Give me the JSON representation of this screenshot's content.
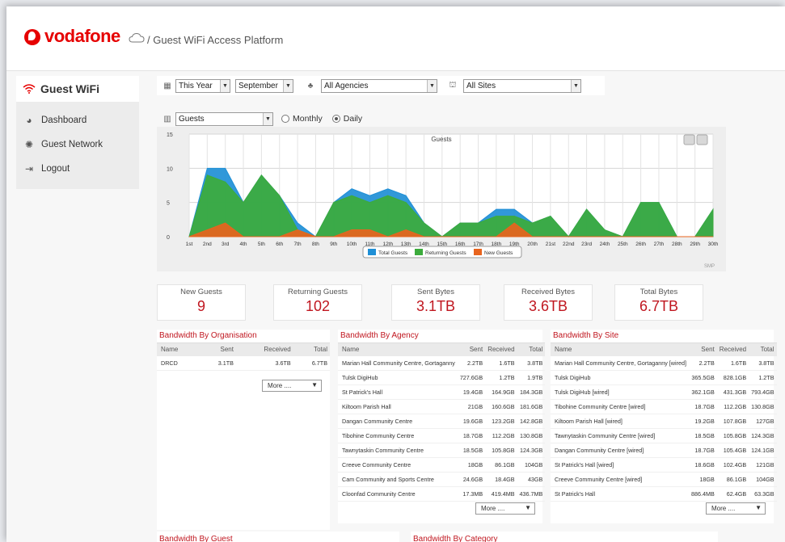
{
  "header": {
    "brand": "vodafone",
    "breadcrumb": "/ Guest WiFi Access Platform"
  },
  "sidebar": {
    "title": "Guest WiFi",
    "items": [
      {
        "label": "Dashboard",
        "icon": "dashboard-icon"
      },
      {
        "label": "Guest Network",
        "icon": "network-icon"
      },
      {
        "label": "Logout",
        "icon": "logout-icon"
      }
    ]
  },
  "filters": {
    "period": "This Year",
    "month": "September",
    "agency": "All Agencies",
    "site": "All Sites",
    "metric": "Guests",
    "granularity_monthly": "Monthly",
    "granularity_daily": "Daily",
    "granularity_selected": "Daily"
  },
  "chart_data": {
    "type": "area",
    "title": "Guests",
    "credit": "SMP",
    "categories": [
      "1st",
      "2nd",
      "3rd",
      "4th",
      "5th",
      "6th",
      "7th",
      "8th",
      "9th",
      "10th",
      "11th",
      "12th",
      "13th",
      "14th",
      "15th",
      "16th",
      "17th",
      "18th",
      "19th",
      "20th",
      "21st",
      "22nd",
      "23rd",
      "24th",
      "25th",
      "26th",
      "27th",
      "28th",
      "29th",
      "30th"
    ],
    "ylim": [
      0,
      15
    ],
    "yticks": [
      0,
      5,
      10,
      15
    ],
    "legend_position": "bottom",
    "series": [
      {
        "name": "Total Guests",
        "color": "#1f8fd6",
        "values": [
          0,
          10,
          10,
          5,
          9,
          6,
          2,
          0,
          5,
          7,
          6,
          7,
          6,
          2,
          0,
          2,
          2,
          4,
          4,
          2,
          3,
          0,
          4,
          1,
          0,
          5,
          5,
          0,
          0,
          4
        ]
      },
      {
        "name": "Returning Guests",
        "color": "#3cab3c",
        "values": [
          0,
          9,
          8,
          5,
          9,
          6,
          1,
          0,
          5,
          6,
          5,
          6,
          5,
          2,
          0,
          2,
          2,
          3,
          3,
          2,
          3,
          0,
          4,
          1,
          0,
          5,
          5,
          0,
          0,
          4
        ]
      },
      {
        "name": "New Guests",
        "color": "#e8641e",
        "values": [
          0,
          1,
          2,
          0,
          0,
          0,
          1,
          0,
          0,
          1,
          1,
          0,
          1,
          0,
          0,
          0,
          0,
          0,
          2,
          0,
          0,
          0,
          0,
          0,
          0,
          0,
          0,
          0,
          0,
          0
        ]
      }
    ]
  },
  "kpis": [
    {
      "label": "New Guests",
      "value": "9"
    },
    {
      "label": "Returning Guests",
      "value": "102"
    },
    {
      "label": "Sent Bytes",
      "value": "3.1TB"
    },
    {
      "label": "Received Bytes",
      "value": "3.6TB"
    },
    {
      "label": "Total Bytes",
      "value": "6.7TB"
    }
  ],
  "org_panel": {
    "title": "Bandwidth By Organisation",
    "headers": [
      "Name",
      "Sent",
      "Received",
      "Total"
    ],
    "rows": [
      [
        "DRCD",
        "3.1TB",
        "3.6TB",
        "6.7TB"
      ]
    ],
    "more": "More ...."
  },
  "agency_panel": {
    "title": "Bandwidth By Agency",
    "headers": [
      "Name",
      "Sent",
      "Received",
      "Total"
    ],
    "rows": [
      [
        "Marian Hall Community Centre, Gortaganny",
        "2.2TB",
        "1.6TB",
        "3.8TB"
      ],
      [
        "Tulsk DigiHub",
        "727.6GB",
        "1.2TB",
        "1.9TB"
      ],
      [
        "St Patrick's Hall",
        "19.4GB",
        "164.9GB",
        "184.3GB"
      ],
      [
        "Kiltoom Parish Hall",
        "21GB",
        "160.6GB",
        "181.6GB"
      ],
      [
        "Dangan Community Centre",
        "19.6GB",
        "123.2GB",
        "142.8GB"
      ],
      [
        "Tibohine Community Centre",
        "18.7GB",
        "112.2GB",
        "130.8GB"
      ],
      [
        "Tawnytaskin Community Centre",
        "18.5GB",
        "105.8GB",
        "124.3GB"
      ],
      [
        "Creeve Community Centre",
        "18GB",
        "86.1GB",
        "104GB"
      ],
      [
        "Cam Community and Sports Centre",
        "24.6GB",
        "18.4GB",
        "43GB"
      ],
      [
        "Cloonfad Community Centre",
        "17.3MB",
        "419.4MB",
        "436.7MB"
      ]
    ],
    "more": "More ...."
  },
  "site_panel": {
    "title": "Bandwidth By Site",
    "headers": [
      "Name",
      "Sent",
      "Received",
      "Total"
    ],
    "rows": [
      [
        "Marian Hall Community Centre, Gortaganny [wired]",
        "2.2TB",
        "1.6TB",
        "3.8TB"
      ],
      [
        "Tulsk DigiHub",
        "365.5GB",
        "828.1GB",
        "1.2TB"
      ],
      [
        "Tulsk DigiHub [wired]",
        "362.1GB",
        "431.3GB",
        "793.4GB"
      ],
      [
        "Tibohine Community Centre [wired]",
        "18.7GB",
        "112.2GB",
        "130.8GB"
      ],
      [
        "Kiltoom Parish Hall [wired]",
        "19.2GB",
        "107.8GB",
        "127GB"
      ],
      [
        "Tawnytaskin Community Centre [wired]",
        "18.5GB",
        "105.8GB",
        "124.3GB"
      ],
      [
        "Dangan Community Centre [wired]",
        "18.7GB",
        "105.4GB",
        "124.1GB"
      ],
      [
        "St Patrick's Hall [wired]",
        "18.6GB",
        "102.4GB",
        "121GB"
      ],
      [
        "Creeve Community Centre [wired]",
        "18GB",
        "86.1GB",
        "104GB"
      ],
      [
        "St Patrick's Hall",
        "886.4MB",
        "62.4GB",
        "63.3GB"
      ]
    ],
    "more": "More ...."
  },
  "bottom": {
    "guest_title": "Bandwidth By Guest",
    "category_title": "Bandwidth By Category"
  }
}
